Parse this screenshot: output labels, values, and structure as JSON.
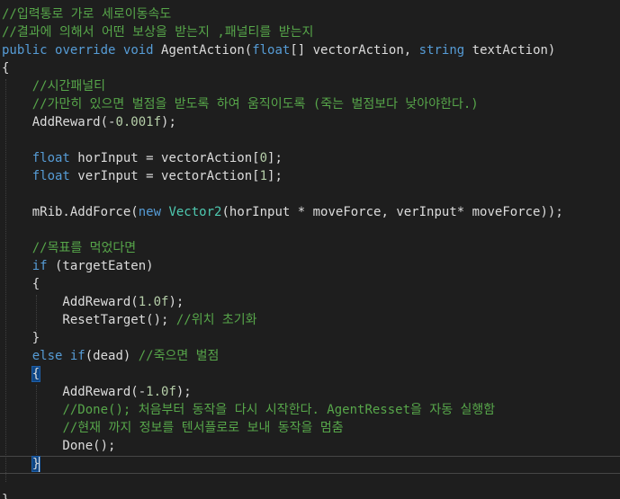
{
  "editor": {
    "lines": [
      [
        {
          "t": "//입력통로 가로 세로이동속도",
          "k": "comment"
        }
      ],
      [
        {
          "t": "//결과에 의해서 어떤 보상을 받는지 ,패널티를 받는지",
          "k": "comment"
        }
      ],
      [
        {
          "t": "public",
          "k": "kw"
        },
        {
          "t": " ",
          "k": "text"
        },
        {
          "t": "override",
          "k": "kw"
        },
        {
          "t": " ",
          "k": "text"
        },
        {
          "t": "void",
          "k": "kw"
        },
        {
          "t": " AgentAction(",
          "k": "text"
        },
        {
          "t": "float",
          "k": "kw"
        },
        {
          "t": "[] vectorAction, ",
          "k": "text"
        },
        {
          "t": "string",
          "k": "kw"
        },
        {
          "t": " textAction)",
          "k": "text"
        }
      ],
      [
        {
          "t": "{",
          "k": "text"
        }
      ],
      [
        {
          "t": "    ",
          "k": "text"
        },
        {
          "t": "//시간패널티",
          "k": "comment"
        }
      ],
      [
        {
          "t": "    ",
          "k": "text"
        },
        {
          "t": "//가만히 있으면 벌점을 받도록 하여 움직이도록 (죽는 벌점보다 낮아야한다.)",
          "k": "comment"
        }
      ],
      [
        {
          "t": "    AddReward(-",
          "k": "text"
        },
        {
          "t": "0.001f",
          "k": "num"
        },
        {
          "t": ");",
          "k": "text"
        }
      ],
      [],
      [
        {
          "t": "    ",
          "k": "text"
        },
        {
          "t": "float",
          "k": "kw"
        },
        {
          "t": " horInput = vectorAction[",
          "k": "text"
        },
        {
          "t": "0",
          "k": "num"
        },
        {
          "t": "];",
          "k": "text"
        }
      ],
      [
        {
          "t": "    ",
          "k": "text"
        },
        {
          "t": "float",
          "k": "kw"
        },
        {
          "t": " verInput = vectorAction[",
          "k": "text"
        },
        {
          "t": "1",
          "k": "num"
        },
        {
          "t": "];",
          "k": "text"
        }
      ],
      [],
      [
        {
          "t": "    mRib.AddForce(",
          "k": "text"
        },
        {
          "t": "new",
          "k": "kw"
        },
        {
          "t": " ",
          "k": "text"
        },
        {
          "t": "Vector2",
          "k": "type"
        },
        {
          "t": "(horInput * moveForce, verInput* moveForce));",
          "k": "text"
        }
      ],
      [],
      [
        {
          "t": "    ",
          "k": "text"
        },
        {
          "t": "//목표를 먹었다면",
          "k": "comment"
        }
      ],
      [
        {
          "t": "    ",
          "k": "text"
        },
        {
          "t": "if",
          "k": "kw"
        },
        {
          "t": " (targetEaten)",
          "k": "text"
        }
      ],
      [
        {
          "t": "    {",
          "k": "text"
        }
      ],
      [
        {
          "t": "        AddReward(",
          "k": "text"
        },
        {
          "t": "1.0f",
          "k": "num"
        },
        {
          "t": ");",
          "k": "text"
        }
      ],
      [
        {
          "t": "        ResetTarget(); ",
          "k": "text"
        },
        {
          "t": "//위치 초기화",
          "k": "comment"
        }
      ],
      [
        {
          "t": "    }",
          "k": "text"
        }
      ],
      [
        {
          "t": "    ",
          "k": "text"
        },
        {
          "t": "else",
          "k": "kw"
        },
        {
          "t": " ",
          "k": "text"
        },
        {
          "t": "if",
          "k": "kw"
        },
        {
          "t": "(dead) ",
          "k": "text"
        },
        {
          "t": "//죽으면 벌점",
          "k": "comment"
        }
      ],
      [
        {
          "t": "    ",
          "k": "text"
        },
        {
          "t": "{",
          "k": "brace"
        }
      ],
      [
        {
          "t": "        AddReward(-",
          "k": "text"
        },
        {
          "t": "1.0f",
          "k": "num"
        },
        {
          "t": ");",
          "k": "text"
        }
      ],
      [
        {
          "t": "        ",
          "k": "text"
        },
        {
          "t": "//Done(); 처음부터 동작을 다시 시작한다. AgentResset을 자동 실행함",
          "k": "comment"
        }
      ],
      [
        {
          "t": "        ",
          "k": "text"
        },
        {
          "t": "//현재 까지 정보를 텐서플로로 보내 동작을 멈춤",
          "k": "comment"
        }
      ],
      [
        {
          "t": "        Done();",
          "k": "text"
        }
      ],
      [
        {
          "t": "    ",
          "k": "text"
        },
        {
          "t": "}",
          "k": "brace"
        }
      ],
      [],
      [
        {
          "t": "}",
          "k": "text"
        }
      ]
    ],
    "colors": {
      "background": "#1e1e1e",
      "text": "#dcdcdc",
      "keyword": "#569cd6",
      "type": "#4ec9b0",
      "comment": "#57a64a",
      "number": "#b5cea8",
      "brace_highlight": "#0e4583"
    }
  }
}
